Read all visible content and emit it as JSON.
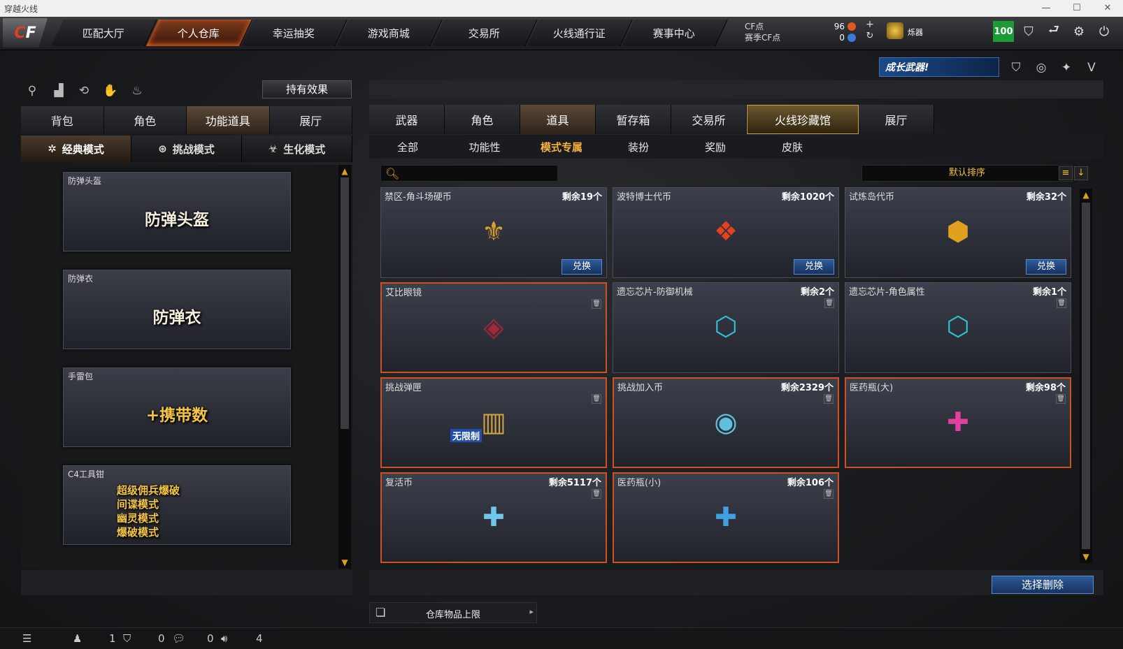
{
  "window": {
    "title": "穿越火线",
    "controls": [
      "—",
      "☐",
      "✕"
    ]
  },
  "logo": {
    "text_a": "C",
    "text_b": "F"
  },
  "nav": [
    "匹配大厅",
    "个人仓库",
    "幸运抽奖",
    "游戏商城",
    "交易所",
    "火线通行证",
    "赛事中心"
  ],
  "currency": {
    "cf_label": "CF点",
    "cf_value": "96",
    "match_label": "赛季CF点",
    "match_value": "0"
  },
  "rank_name": "烁器",
  "level": "100",
  "banner": {
    "text": "成长武器!"
  },
  "hold_effect": "持有效果",
  "left_tabs": [
    "背包",
    "角色",
    "功能道具",
    "展厅"
  ],
  "modes": [
    {
      "label": "经典模式",
      "icon": "✲"
    },
    {
      "label": "挑战模式",
      "icon": "⊛"
    },
    {
      "label": "生化模式",
      "icon": "☣"
    }
  ],
  "left_items": [
    {
      "label": "防弹头盔",
      "art": "防弹头盔"
    },
    {
      "label": "防弹衣",
      "art": "防弹衣"
    },
    {
      "label": "手雷包",
      "art": "+携带数"
    },
    {
      "label": "C4工具钳",
      "art_lines": [
        "超级佣兵爆破",
        "间谍模式",
        "幽灵模式",
        "爆破模式"
      ]
    }
  ],
  "right_tabs": [
    "武器",
    "角色",
    "道具",
    "暂存箱",
    "交易所",
    "火线珍藏馆",
    "展厅"
  ],
  "sub_tabs": [
    "全部",
    "功能性",
    "模式专属",
    "装扮",
    "奖励",
    "皮肤"
  ],
  "sort_label": "默认排序",
  "items": [
    {
      "name": "禁区-角斗场硬币",
      "count": "剩余19个",
      "exchange": "兑换",
      "icon": "⚜",
      "color": "#d8a030"
    },
    {
      "name": "波特博士代币",
      "count": "剩余1020个",
      "exchange": "兑换",
      "icon": "❖",
      "color": "#e84020"
    },
    {
      "name": "试炼岛代币",
      "count": "剩余32个",
      "exchange": "兑换",
      "icon": "⬢",
      "color": "#e0a020"
    },
    {
      "name": "艾比眼镜",
      "count": "",
      "icon": "◈",
      "color": "#8a2030"
    },
    {
      "name": "遗忘芯片-防御机械",
      "count": "剩余2个",
      "icon": "⬡",
      "color": "#30c0d0"
    },
    {
      "name": "遗忘芯片-角色属性",
      "count": "剩余1个",
      "icon": "⬡",
      "color": "#30c0d0"
    },
    {
      "name": "挑战弹匣",
      "count": "",
      "icon": "▥",
      "color": "#d0a040",
      "tag": "无限制"
    },
    {
      "name": "挑战加入币",
      "count": "剩余2329个",
      "icon": "◉",
      "color": "#60c0e0"
    },
    {
      "name": "医药瓶(大)",
      "count": "剩余98个",
      "icon": "✚",
      "color": "#e040a0"
    },
    {
      "name": "复活币",
      "count": "剩余5117个",
      "icon": "✚",
      "color": "#70c8e8"
    },
    {
      "name": "医药瓶(小)",
      "count": "剩余106个",
      "icon": "✚",
      "color": "#40a0e0"
    }
  ],
  "select_delete": "选择删除",
  "storage_limit": "仓库物品上限",
  "status": {
    "a": "1",
    "b": "0",
    "c": "0",
    "d": "4"
  }
}
